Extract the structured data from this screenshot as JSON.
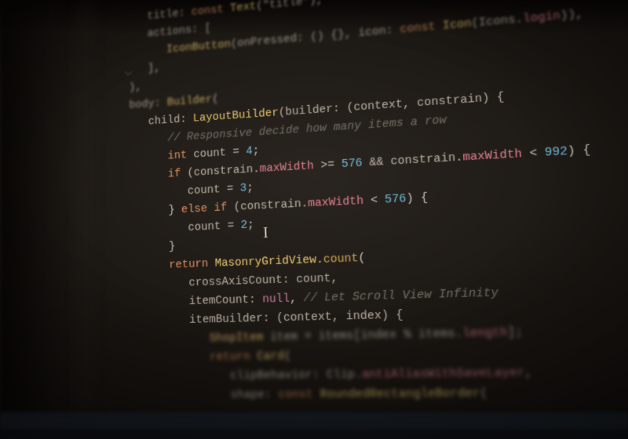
{
  "editor": {
    "caret_glyph": "I",
    "lines": [
      {
        "indent": 2,
        "blur": "blur-top",
        "tokens": [
          {
            "t": "title: ",
            "c": "id"
          },
          {
            "t": "const ",
            "c": "kw"
          },
          {
            "t": "Text",
            "c": "cls"
          },
          {
            "t": "(",
            "c": "op"
          },
          {
            "t": "\"title\"",
            "c": "id"
          },
          {
            "t": "),",
            "c": "op"
          }
        ]
      },
      {
        "indent": 2,
        "blur": "blur-top",
        "tokens": [
          {
            "t": "actions: [",
            "c": "id"
          }
        ]
      },
      {
        "indent": 3,
        "blur": "blur-top",
        "tokens": [
          {
            "t": "IconButton",
            "c": "cls"
          },
          {
            "t": "(onPressed: () {}, icon: ",
            "c": "id"
          },
          {
            "t": "const ",
            "c": "kw"
          },
          {
            "t": "Icon",
            "c": "cls"
          },
          {
            "t": "(Icons.",
            "c": "id"
          },
          {
            "t": "login",
            "c": "prop"
          },
          {
            "t": ")),",
            "c": "op"
          }
        ]
      },
      {
        "indent": 2,
        "blur": "blur-top",
        "tokens": [
          {
            "t": "],",
            "c": "op"
          }
        ]
      },
      {
        "indent": 1,
        "blur": "blur-top",
        "tokens": [
          {
            "t": "),",
            "c": "op"
          }
        ]
      },
      {
        "indent": 1,
        "blur": "blur-top",
        "tokens": [
          {
            "t": "body: ",
            "c": "id"
          },
          {
            "t": "Builder",
            "c": "cls"
          },
          {
            "t": "(",
            "c": "op"
          }
        ]
      },
      {
        "indent": 2,
        "blur": "blur-mid",
        "tokens": [
          {
            "t": "child: ",
            "c": "id"
          },
          {
            "t": "LayoutBuilder",
            "c": "cls"
          },
          {
            "t": "(builder: (context, constrain) {",
            "c": "id"
          }
        ]
      },
      {
        "indent": 3,
        "blur": "blur-mid",
        "tokens": [
          {
            "t": "// Responsive decide how many items a row",
            "c": "cm"
          }
        ]
      },
      {
        "indent": 3,
        "blur": "",
        "tokens": [
          {
            "t": "int",
            "c": "kw"
          },
          {
            "t": " count = ",
            "c": "id"
          },
          {
            "t": "4",
            "c": "num"
          },
          {
            "t": ";",
            "c": "op"
          }
        ]
      },
      {
        "indent": 3,
        "blur": "",
        "tokens": [
          {
            "t": "if ",
            "c": "kw"
          },
          {
            "t": "(constrain.",
            "c": "id"
          },
          {
            "t": "maxWidth",
            "c": "prop"
          },
          {
            "t": " >= ",
            "c": "op"
          },
          {
            "t": "576",
            "c": "num"
          },
          {
            "t": " && constrain.",
            "c": "id"
          },
          {
            "t": "maxWidth",
            "c": "prop"
          },
          {
            "t": " < ",
            "c": "op"
          },
          {
            "t": "992",
            "c": "num"
          },
          {
            "t": ") {",
            "c": "op"
          }
        ]
      },
      {
        "indent": 4,
        "blur": "",
        "tokens": [
          {
            "t": "count = ",
            "c": "id"
          },
          {
            "t": "3",
            "c": "num"
          },
          {
            "t": ";",
            "c": "op"
          }
        ]
      },
      {
        "indent": 3,
        "blur": "",
        "tokens": [
          {
            "t": "} ",
            "c": "op"
          },
          {
            "t": "else if ",
            "c": "kw"
          },
          {
            "t": "(constrain.",
            "c": "id"
          },
          {
            "t": "maxWidth",
            "c": "prop"
          },
          {
            "t": " < ",
            "c": "op"
          },
          {
            "t": "576",
            "c": "num"
          },
          {
            "t": ") {",
            "c": "op"
          }
        ]
      },
      {
        "indent": 4,
        "blur": "",
        "tokens": [
          {
            "t": "count = ",
            "c": "id"
          },
          {
            "t": "2",
            "c": "num"
          },
          {
            "t": ";",
            "c": "op"
          }
        ]
      },
      {
        "indent": 3,
        "blur": "",
        "tokens": [
          {
            "t": "}",
            "c": "op"
          }
        ]
      },
      {
        "indent": 3,
        "blur": "",
        "tokens": [
          {
            "t": "return ",
            "c": "kw"
          },
          {
            "t": "MasonryGridView",
            "c": "cls"
          },
          {
            "t": ".",
            "c": "op"
          },
          {
            "t": "count",
            "c": "fn"
          },
          {
            "t": "(",
            "c": "op"
          }
        ]
      },
      {
        "indent": 4,
        "blur": "blur-mid",
        "tokens": [
          {
            "t": "crossAxisCount: count,",
            "c": "id"
          }
        ]
      },
      {
        "indent": 4,
        "blur": "blur-mid",
        "tokens": [
          {
            "t": "itemCount: ",
            "c": "id"
          },
          {
            "t": "null",
            "c": "nul"
          },
          {
            "t": ", ",
            "c": "op"
          },
          {
            "t": "// Let Scroll View Infinity",
            "c": "cm"
          }
        ]
      },
      {
        "indent": 4,
        "blur": "blur-mid",
        "tokens": [
          {
            "t": "itemBuilder: (context, index) {",
            "c": "id"
          }
        ]
      },
      {
        "indent": 5,
        "blur": "blur-bot",
        "tokens": [
          {
            "t": "ShopItem",
            "c": "cls"
          },
          {
            "t": " item = items[index % items.",
            "c": "id"
          },
          {
            "t": "length",
            "c": "prop"
          },
          {
            "t": "];",
            "c": "op"
          }
        ]
      },
      {
        "indent": 5,
        "blur": "blur-bot",
        "tokens": [
          {
            "t": "return ",
            "c": "kw"
          },
          {
            "t": "Card",
            "c": "cls"
          },
          {
            "t": "(",
            "c": "op"
          }
        ]
      },
      {
        "indent": 6,
        "blur": "blur-bot",
        "tokens": [
          {
            "t": "clipBehavior: Clip.",
            "c": "id"
          },
          {
            "t": "antiAliasWithSaveLayer",
            "c": "prop"
          },
          {
            "t": ",",
            "c": "op"
          }
        ]
      },
      {
        "indent": 6,
        "blur": "blur-bot",
        "tokens": [
          {
            "t": "shape: ",
            "c": "id"
          },
          {
            "t": "const ",
            "c": "kw"
          },
          {
            "t": "RoundedRectangleBorder",
            "c": "cls"
          },
          {
            "t": "(",
            "c": "op"
          }
        ]
      }
    ]
  }
}
